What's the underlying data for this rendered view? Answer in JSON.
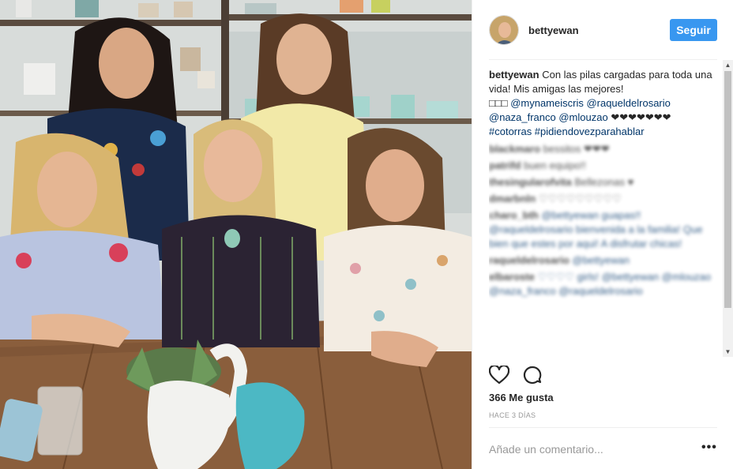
{
  "post": {
    "username": "bettyewan",
    "follow_label": "Seguir",
    "caption_user": "bettyewan",
    "caption_text": "Con las pilas cargadas para toda una vida! Mis amigas las mejores!",
    "caption_squares": "□□□",
    "caption_mentions": "@mynameiscris @raqueldelrosario @naza_franco @mlouzao",
    "caption_hearts": "❤❤❤❤❤❤❤",
    "caption_tags": "#cotorras #pidiendovezparahablar",
    "likes": "366 Me gusta",
    "time_ago": "HACE 3 DÍAS",
    "comment_placeholder": "Añade un comentario...",
    "more_label": "•••"
  },
  "comments": [
    {
      "user": "blackmaro",
      "text": "bessitos ❤❤❤"
    },
    {
      "user": "patrifd",
      "text": "buen equipo!!"
    },
    {
      "user": "thesingularofvita",
      "text": "Bellezonas ♥"
    },
    {
      "user": "dmarbnln",
      "text": "♡♡♡♡♡♡♡♡♡"
    },
    {
      "user": "charo_bth",
      "text": "@bettyewan guapas!! @raqueldelrosario bienvenida a la familia! Que bien que estes por aqui! A disfrutar chicas!"
    },
    {
      "user": "raqueldelrosario",
      "text": "@bettyewan"
    },
    {
      "user": "elbaroste",
      "text": "♡♡♡♡ girls! @bettyewan @mlouzao @naza_franco @raqueldelrosario"
    }
  ],
  "icons": {
    "like": "heart-icon",
    "comment": "comment-bubble-icon"
  },
  "colors": {
    "follow_button": "#3897f0",
    "mention_link": "#003569",
    "muted_text": "#999999"
  }
}
